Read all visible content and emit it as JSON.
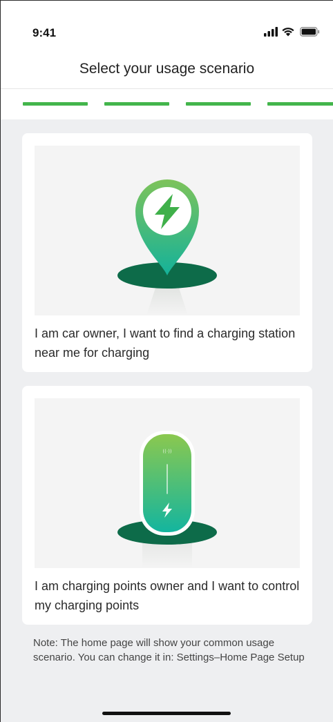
{
  "status_bar": {
    "time": "9:41",
    "icons": [
      "cellular-signal-icon",
      "wifi-icon",
      "battery-icon"
    ]
  },
  "header": {
    "title": "Select your usage scenario"
  },
  "progress": {
    "segments": 4,
    "color": "#43b54b"
  },
  "options": [
    {
      "image": "location-pin-charging-icon",
      "label": "I am car owner, I want to find a charging station near me for charging"
    },
    {
      "image": "wallbox-charger-icon",
      "label": "I am charging points owner and I want to control my charging points"
    }
  ],
  "note": "Note: The home page will show your common usage scenario. You can change it in: Settings–Home Page Setup",
  "colors": {
    "brand_green": "#43b54b",
    "dark_green": "#0d6b49",
    "background": "#eeeff1"
  }
}
